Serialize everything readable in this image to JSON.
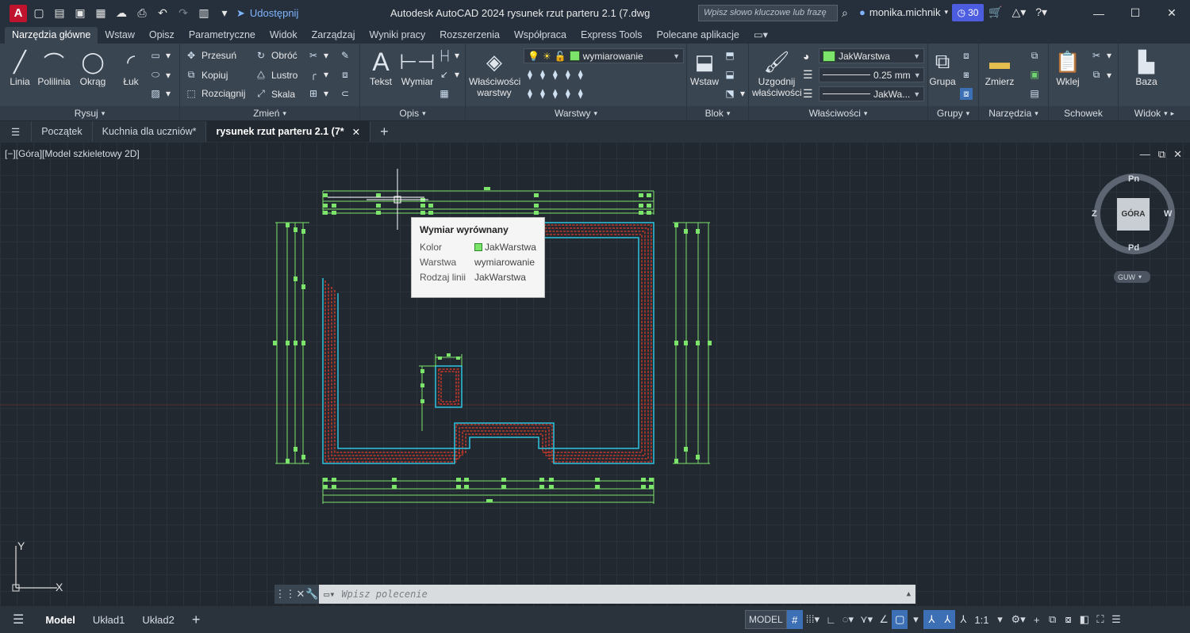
{
  "titlebar": {
    "app_letter": "A",
    "share_label": "Udostępnij",
    "title": "Autodesk AutoCAD 2024    rysunek rzut parteru 2.1 (7.dwg",
    "search_placeholder": "Wpisz słowo kluczowe lub frazę",
    "user": "monika.michnik",
    "trial_days": "30"
  },
  "ribbon_tabs": [
    "Narzędzia główne",
    "Wstaw",
    "Opisz",
    "Parametryczne",
    "Widok",
    "Zarządzaj",
    "Wyniki pracy",
    "Rozszerzenia",
    "Współpraca",
    "Express Tools",
    "Polecane aplikacje"
  ],
  "panels": {
    "rysuj": {
      "title": "Rysuj",
      "linia": "Linia",
      "polilinia": "Polilinia",
      "okrag": "Okrąg",
      "luk": "Łuk"
    },
    "zmien": {
      "title": "Zmień",
      "przesun": "Przesuń",
      "obroc": "Obróć",
      "kopiuj": "Kopiuj",
      "lustro": "Lustro",
      "rozciagnij": "Rozciągnij",
      "skala": "Skala"
    },
    "opis": {
      "title": "Opis",
      "tekst": "Tekst",
      "wymiar": "Wymiar"
    },
    "warstwy": {
      "title": "Warstwy",
      "wlasciwosci_warstwy_1": "Właściwości",
      "wlasciwosci_warstwy_2": "warstwy",
      "layer": "wymiarowanie"
    },
    "blok": {
      "title": "Blok",
      "wstaw": "Wstaw"
    },
    "wlasciwosci": {
      "title": "Właściwości",
      "uzgodnij_1": "Uzgodnij",
      "uzgodnij_2": "właściwości",
      "color": "JakWarstwa",
      "lineweight": "0.25 mm",
      "linetype": "JakWa..."
    },
    "grupy": {
      "title": "Grupy",
      "grupa": "Grupa"
    },
    "narzedzia": {
      "title": "Narzędzia",
      "zmierz": "Zmierz"
    },
    "schowek": {
      "title": "Schowek",
      "wklej": "Wklej"
    },
    "widok": {
      "title": "Widok",
      "baza": "Baza"
    }
  },
  "doc_tabs": [
    "Początek",
    "Kuchnia dla uczniów*",
    "rysunek rzut parteru 2.1 (7*"
  ],
  "viewport": {
    "label": "[−][Góra][Model szkieletowy 2D]"
  },
  "tooltip": {
    "title": "Wymiar wyrównany",
    "rows": [
      {
        "key": "Kolor",
        "value": "JakWarstwa"
      },
      {
        "key": "Warstwa",
        "value": "wymiarowanie"
      },
      {
        "key": "Rodzaj linii",
        "value": "JakWarstwa"
      }
    ]
  },
  "viewcube": {
    "north": "Pn",
    "south": "Pd",
    "east": "W",
    "west": "Z",
    "face": "GÓRA",
    "ucs": "GUW"
  },
  "ucs_icon": {
    "x": "X",
    "y": "Y"
  },
  "command": {
    "placeholder": "Wpisz polecenie"
  },
  "layout_tabs": [
    "Model",
    "Układ1",
    "Układ2"
  ],
  "status": {
    "model": "MODEL",
    "scale": "1:1"
  },
  "colors": {
    "accent": "#3c6fb4",
    "dim_green": "#7de46b",
    "wall_red": "#c0392b",
    "wall_cyan": "#2ec4e0"
  }
}
